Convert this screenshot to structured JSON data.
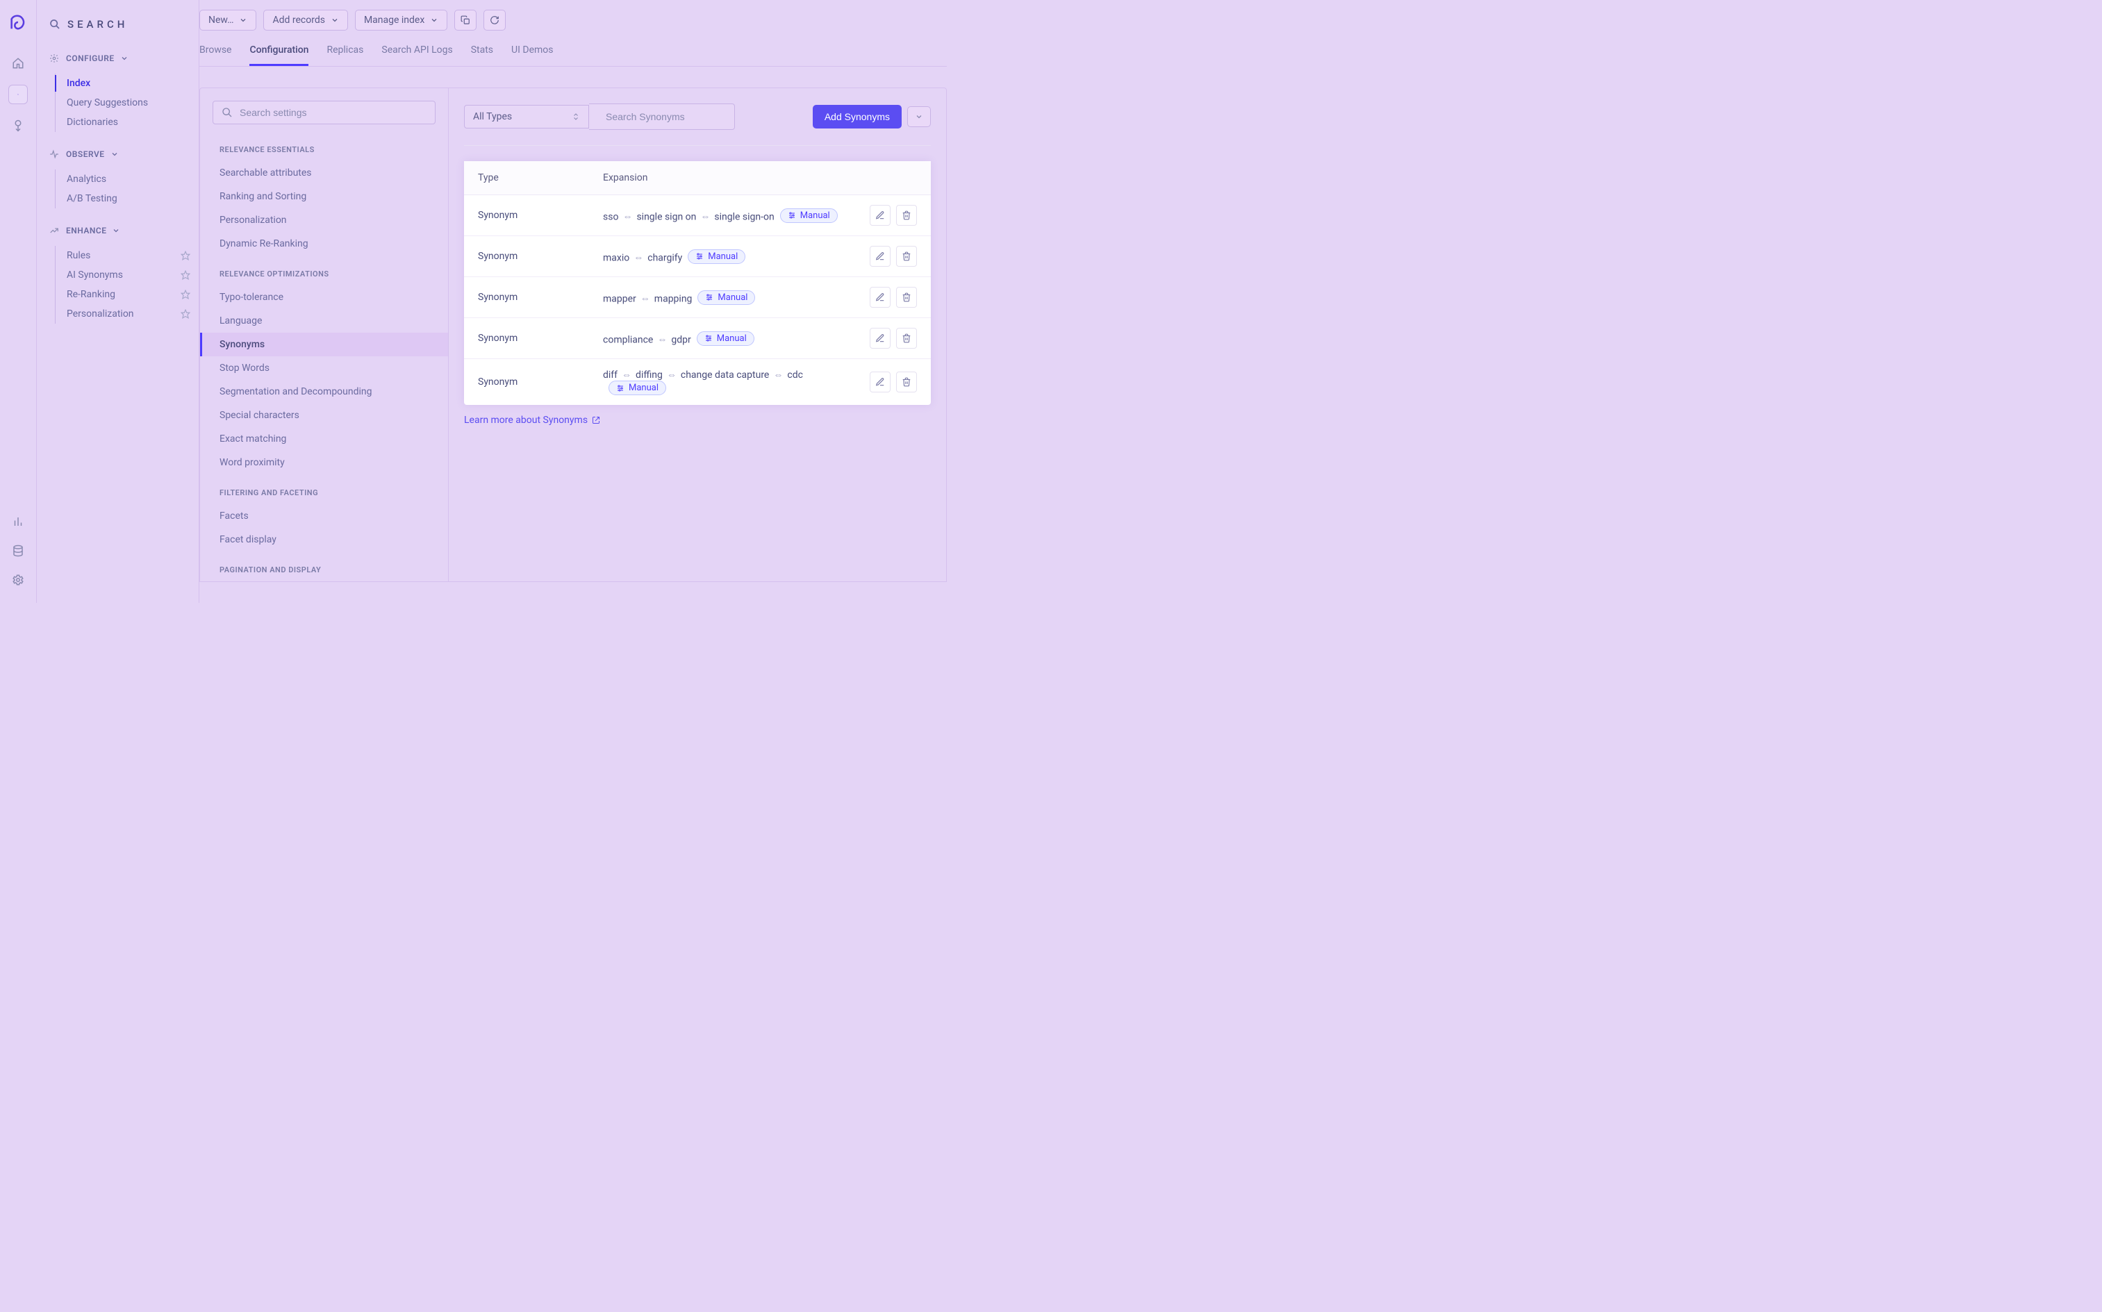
{
  "app_header": "SEARCH",
  "toolbar": {
    "new": "New…",
    "add_records": "Add records",
    "manage_index": "Manage index"
  },
  "tabs": [
    "Browse",
    "Configuration",
    "Replicas",
    "Search API Logs",
    "Stats",
    "UI Demos"
  ],
  "active_tab": "Configuration",
  "sidebar": {
    "sections": [
      {
        "title": "CONFIGURE",
        "items": [
          "Index",
          "Query Suggestions",
          "Dictionaries"
        ],
        "active": "Index"
      },
      {
        "title": "OBSERVE",
        "items": [
          "Analytics",
          "A/B Testing"
        ]
      },
      {
        "title": "ENHANCE",
        "items": [
          "Rules",
          "AI Synonyms",
          "Re-Ranking",
          "Personalization"
        ],
        "stars": true
      }
    ]
  },
  "settings_search_placeholder": "Search settings",
  "settings_groups": [
    {
      "title": "RELEVANCE ESSENTIALS",
      "items": [
        "Searchable attributes",
        "Ranking and Sorting",
        "Personalization",
        "Dynamic Re-Ranking"
      ]
    },
    {
      "title": "RELEVANCE OPTIMIZATIONS",
      "items": [
        "Typo-tolerance",
        "Language",
        "Synonyms",
        "Stop Words",
        "Segmentation and Decompounding",
        "Special characters",
        "Exact matching",
        "Word proximity"
      ]
    },
    {
      "title": "FILTERING AND FACETING",
      "items": [
        "Facets",
        "Facet display"
      ]
    },
    {
      "title": "PAGINATION AND DISPLAY",
      "items": []
    }
  ],
  "settings_active": "Synonyms",
  "synonyms_panel": {
    "type_filter": "All Types",
    "search_placeholder": "Search Synonyms",
    "add_button": "Add Synonyms",
    "columns": {
      "type": "Type",
      "expansion": "Expansion"
    },
    "badge_label": "Manual",
    "rows": [
      {
        "type": "Synonym",
        "terms": [
          "sso",
          "single sign on",
          "single sign-on"
        ]
      },
      {
        "type": "Synonym",
        "terms": [
          "maxio",
          "chargify"
        ]
      },
      {
        "type": "Synonym",
        "terms": [
          "mapper",
          "mapping"
        ]
      },
      {
        "type": "Synonym",
        "terms": [
          "compliance",
          "gdpr"
        ]
      },
      {
        "type": "Synonym",
        "terms": [
          "diff",
          "diffing",
          "change data capture",
          "cdc"
        ]
      }
    ],
    "learn_more": "Learn more about Synonyms"
  }
}
